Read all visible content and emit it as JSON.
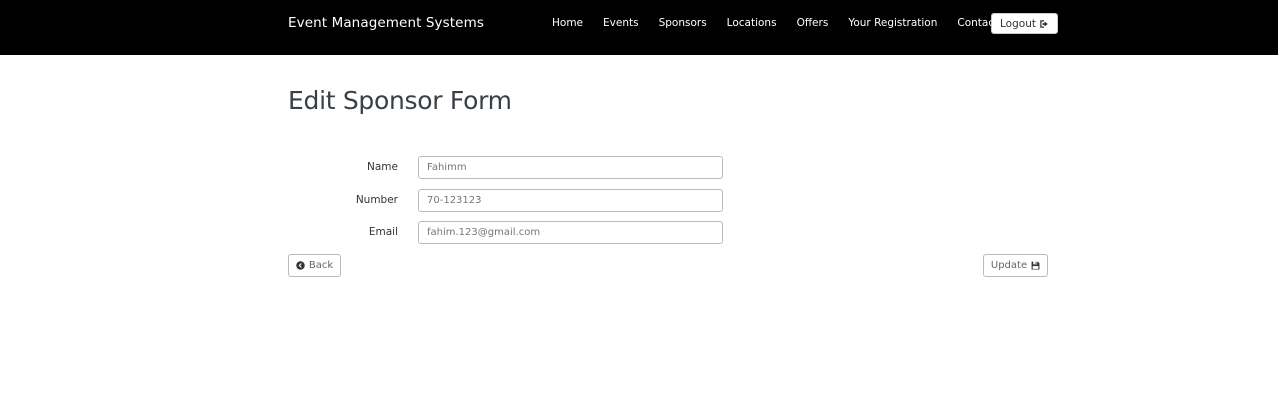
{
  "navbar": {
    "brand": "Event Management Systems",
    "links": [
      "Home",
      "Events",
      "Sponsors",
      "Locations",
      "Offers",
      "Your Registration",
      "Contact Us"
    ],
    "logout_label": "Logout",
    "logout_icon": "sign-out-icon"
  },
  "page": {
    "title": "Edit Sponsor Form"
  },
  "form": {
    "fields": [
      {
        "label": "Name",
        "value": "Fahimm"
      },
      {
        "label": "Number",
        "value": "70-123123"
      },
      {
        "label": "Email",
        "value": "fahim.123@gmail.com"
      }
    ],
    "back_label": "Back",
    "back_icon": "circle-arrow-left-icon",
    "update_label": "Update",
    "update_icon": "floppy-disk-icon"
  }
}
